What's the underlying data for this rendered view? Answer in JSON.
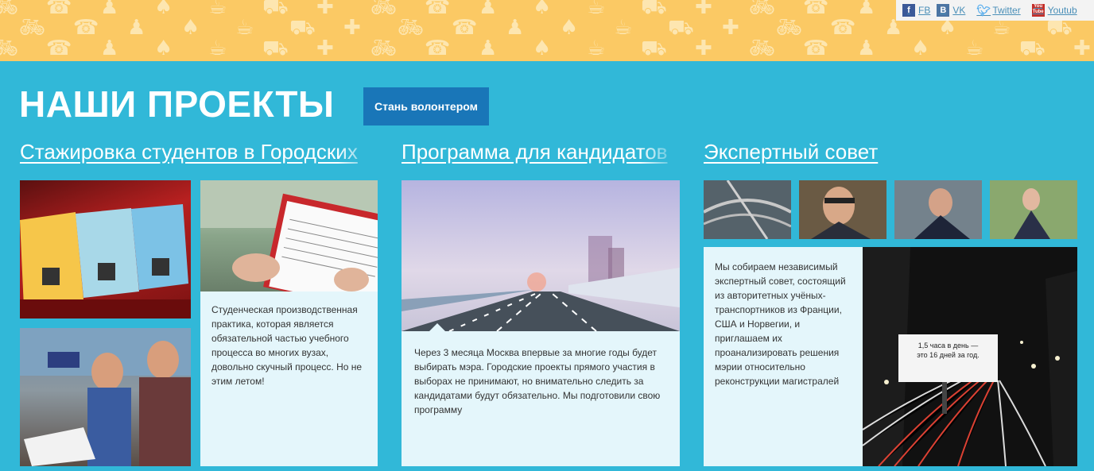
{
  "social": {
    "fb": {
      "icon": "f",
      "label": "FB"
    },
    "vk": {
      "icon": "B",
      "label": "VK"
    },
    "twitter": {
      "icon": "t",
      "label": "Twitter"
    },
    "youtube": {
      "icon": "You\nTube",
      "label": "Youtub"
    }
  },
  "header": {
    "title": "НАШИ ПРОЕКТЫ",
    "volunteer_button": "Стань волонтером"
  },
  "projects": [
    {
      "title": "Стажировка студентов в Городских",
      "text": "Студенческая производственная практика, которая является обязательной частью учебного процесса во многих вузах, довольно скучный процесс. Но не этим летом!"
    },
    {
      "title": "Программа для кандидатов",
      "text": "Через 3 месяца Москва впервые за многие годы будет выбирать мэра. Городские проекты прямого участия в выборах не принимают, но внимательно следить за кандидатами будут обязательно. Мы подготовили свою программу"
    },
    {
      "title": "Экспертный совет",
      "text": "Мы собираем независимый экспертный совет, состоящий из авторитетных учёных-транспортников из Франции, США и Норвегии, и приглашаем их проанализировать решения мэрии относительно реконструкции магистралей",
      "billboard_line1": "1,5 часа в день —",
      "billboard_line2": "это 16 дней за год."
    }
  ],
  "colors": {
    "background": "#31b8d8",
    "banner": "#fbc964",
    "button": "#1976b8",
    "card": "#e4f6fb"
  }
}
